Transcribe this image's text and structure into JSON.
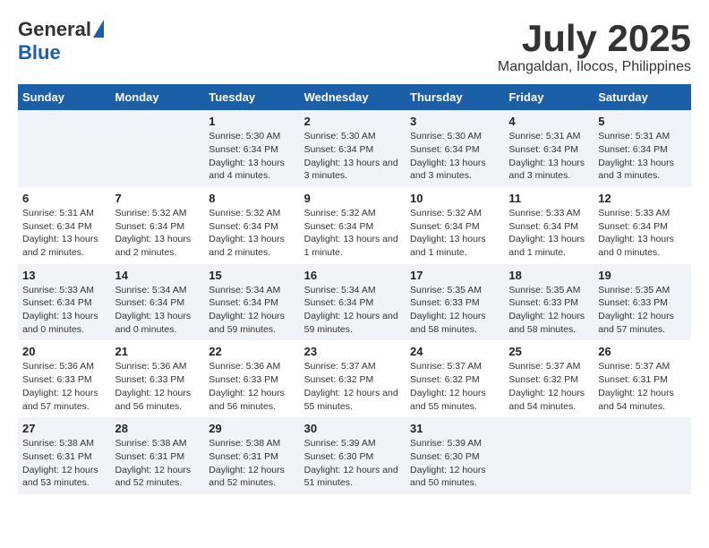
{
  "logo": {
    "general": "General",
    "blue": "Blue"
  },
  "title": "July 2025",
  "location": "Mangaldan, Ilocos, Philippines",
  "days_header": [
    "Sunday",
    "Monday",
    "Tuesday",
    "Wednesday",
    "Thursday",
    "Friday",
    "Saturday"
  ],
  "weeks": [
    [
      {
        "day": "",
        "info": ""
      },
      {
        "day": "",
        "info": ""
      },
      {
        "day": "1",
        "info": "Sunrise: 5:30 AM\nSunset: 6:34 PM\nDaylight: 13 hours and 4 minutes."
      },
      {
        "day": "2",
        "info": "Sunrise: 5:30 AM\nSunset: 6:34 PM\nDaylight: 13 hours and 3 minutes."
      },
      {
        "day": "3",
        "info": "Sunrise: 5:30 AM\nSunset: 6:34 PM\nDaylight: 13 hours and 3 minutes."
      },
      {
        "day": "4",
        "info": "Sunrise: 5:31 AM\nSunset: 6:34 PM\nDaylight: 13 hours and 3 minutes."
      },
      {
        "day": "5",
        "info": "Sunrise: 5:31 AM\nSunset: 6:34 PM\nDaylight: 13 hours and 3 minutes."
      }
    ],
    [
      {
        "day": "6",
        "info": "Sunrise: 5:31 AM\nSunset: 6:34 PM\nDaylight: 13 hours and 2 minutes."
      },
      {
        "day": "7",
        "info": "Sunrise: 5:32 AM\nSunset: 6:34 PM\nDaylight: 13 hours and 2 minutes."
      },
      {
        "day": "8",
        "info": "Sunrise: 5:32 AM\nSunset: 6:34 PM\nDaylight: 13 hours and 2 minutes."
      },
      {
        "day": "9",
        "info": "Sunrise: 5:32 AM\nSunset: 6:34 PM\nDaylight: 13 hours and 1 minute."
      },
      {
        "day": "10",
        "info": "Sunrise: 5:32 AM\nSunset: 6:34 PM\nDaylight: 13 hours and 1 minute."
      },
      {
        "day": "11",
        "info": "Sunrise: 5:33 AM\nSunset: 6:34 PM\nDaylight: 13 hours and 1 minute."
      },
      {
        "day": "12",
        "info": "Sunrise: 5:33 AM\nSunset: 6:34 PM\nDaylight: 13 hours and 0 minutes."
      }
    ],
    [
      {
        "day": "13",
        "info": "Sunrise: 5:33 AM\nSunset: 6:34 PM\nDaylight: 13 hours and 0 minutes."
      },
      {
        "day": "14",
        "info": "Sunrise: 5:34 AM\nSunset: 6:34 PM\nDaylight: 13 hours and 0 minutes."
      },
      {
        "day": "15",
        "info": "Sunrise: 5:34 AM\nSunset: 6:34 PM\nDaylight: 12 hours and 59 minutes."
      },
      {
        "day": "16",
        "info": "Sunrise: 5:34 AM\nSunset: 6:34 PM\nDaylight: 12 hours and 59 minutes."
      },
      {
        "day": "17",
        "info": "Sunrise: 5:35 AM\nSunset: 6:33 PM\nDaylight: 12 hours and 58 minutes."
      },
      {
        "day": "18",
        "info": "Sunrise: 5:35 AM\nSunset: 6:33 PM\nDaylight: 12 hours and 58 minutes."
      },
      {
        "day": "19",
        "info": "Sunrise: 5:35 AM\nSunset: 6:33 PM\nDaylight: 12 hours and 57 minutes."
      }
    ],
    [
      {
        "day": "20",
        "info": "Sunrise: 5:36 AM\nSunset: 6:33 PM\nDaylight: 12 hours and 57 minutes."
      },
      {
        "day": "21",
        "info": "Sunrise: 5:36 AM\nSunset: 6:33 PM\nDaylight: 12 hours and 56 minutes."
      },
      {
        "day": "22",
        "info": "Sunrise: 5:36 AM\nSunset: 6:33 PM\nDaylight: 12 hours and 56 minutes."
      },
      {
        "day": "23",
        "info": "Sunrise: 5:37 AM\nSunset: 6:32 PM\nDaylight: 12 hours and 55 minutes."
      },
      {
        "day": "24",
        "info": "Sunrise: 5:37 AM\nSunset: 6:32 PM\nDaylight: 12 hours and 55 minutes."
      },
      {
        "day": "25",
        "info": "Sunrise: 5:37 AM\nSunset: 6:32 PM\nDaylight: 12 hours and 54 minutes."
      },
      {
        "day": "26",
        "info": "Sunrise: 5:37 AM\nSunset: 6:31 PM\nDaylight: 12 hours and 54 minutes."
      }
    ],
    [
      {
        "day": "27",
        "info": "Sunrise: 5:38 AM\nSunset: 6:31 PM\nDaylight: 12 hours and 53 minutes."
      },
      {
        "day": "28",
        "info": "Sunrise: 5:38 AM\nSunset: 6:31 PM\nDaylight: 12 hours and 52 minutes."
      },
      {
        "day": "29",
        "info": "Sunrise: 5:38 AM\nSunset: 6:31 PM\nDaylight: 12 hours and 52 minutes."
      },
      {
        "day": "30",
        "info": "Sunrise: 5:39 AM\nSunset: 6:30 PM\nDaylight: 12 hours and 51 minutes."
      },
      {
        "day": "31",
        "info": "Sunrise: 5:39 AM\nSunset: 6:30 PM\nDaylight: 12 hours and 50 minutes."
      },
      {
        "day": "",
        "info": ""
      },
      {
        "day": "",
        "info": ""
      }
    ]
  ]
}
